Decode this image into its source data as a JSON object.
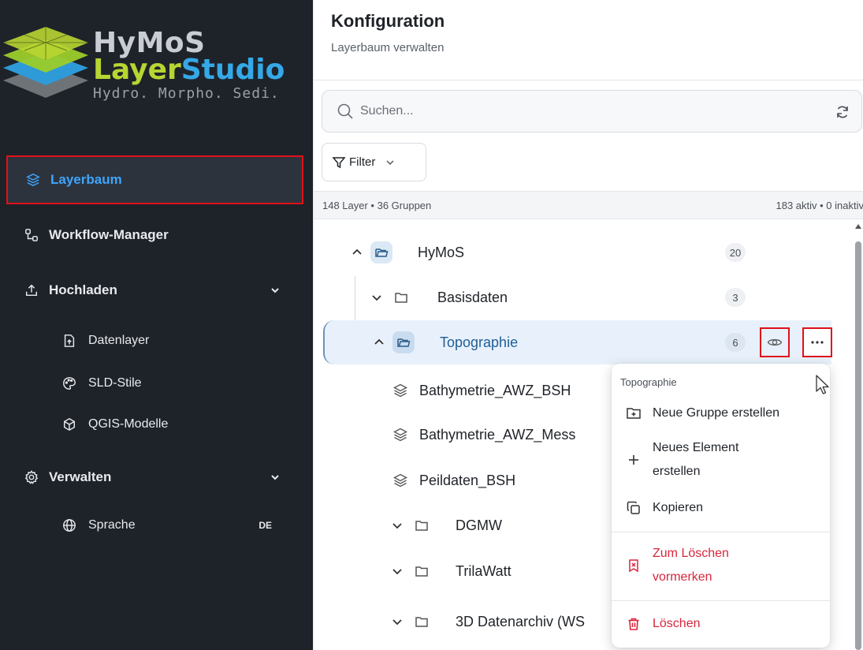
{
  "brand": {
    "name_line1": "HyMoS",
    "name_line2_part1": "Layer",
    "name_line2_part2": "Studio",
    "tagline": "Hydro. Morpho. Sedi."
  },
  "sidebar": {
    "items": [
      {
        "label": "Layerbaum",
        "icon": "layers-icon",
        "active": true
      },
      {
        "label": "Workflow-Manager",
        "icon": "workflow-icon"
      },
      {
        "label": "Hochladen",
        "icon": "upload-icon",
        "expandable": true
      },
      {
        "label": "Datenlayer",
        "icon": "file-upload-icon"
      },
      {
        "label": "SLD-Stile",
        "icon": "palette-icon"
      },
      {
        "label": "QGIS-Modelle",
        "icon": "cube-icon"
      },
      {
        "label": "Verwalten",
        "icon": "settings-icon",
        "expandable": true
      },
      {
        "label": "Sprache",
        "icon": "globe-icon",
        "badge": "DE"
      }
    ]
  },
  "header": {
    "title": "Konfiguration",
    "subtitle": "Layerbaum verwalten"
  },
  "search": {
    "placeholder": "Suchen...",
    "value": ""
  },
  "filter": {
    "label": "Filter"
  },
  "stats": {
    "left": "148 Layer • 36 Gruppen",
    "right": "183 aktiv • 0 inaktiv"
  },
  "tree": {
    "rows": [
      {
        "label": "HyMoS",
        "type": "group",
        "expanded": true,
        "count": "20"
      },
      {
        "label": "Basisdaten",
        "type": "group",
        "expanded": false,
        "count": "3"
      },
      {
        "label": "Topographie",
        "type": "group",
        "expanded": true,
        "count": "6",
        "selected": true
      },
      {
        "label": "Bathymetrie_AWZ_BSH",
        "type": "layer"
      },
      {
        "label": "Bathymetrie_AWZ_Mess",
        "type": "layer"
      },
      {
        "label": "Peildaten_BSH",
        "type": "layer"
      },
      {
        "label": "DGMW",
        "type": "group",
        "expanded": false
      },
      {
        "label": "TrilaWatt",
        "type": "group",
        "expanded": false
      },
      {
        "label": "3D Datenarchiv (WS",
        "type": "group",
        "expanded": false
      }
    ]
  },
  "context_menu": {
    "title": "Topographie",
    "items": [
      {
        "label": "Neue Gruppe erstellen",
        "icon": "folder-plus-icon"
      },
      {
        "label_line1": "Neues Element",
        "label_line2": "erstellen",
        "icon": "plus-icon"
      },
      {
        "label": "Kopieren",
        "icon": "copy-icon"
      },
      {
        "label_line1": "Zum Löschen",
        "label_line2": "vormerken",
        "icon": "bookmark-x-icon",
        "danger": true
      },
      {
        "label": "Löschen",
        "icon": "trash-icon",
        "danger": true
      }
    ]
  },
  "colors": {
    "sidebar_bg": "#1e2329",
    "active_text": "#3fa5ff",
    "highlight_border": "#e0101a",
    "danger": "#d7263d",
    "selected_row": "#e8f1fb"
  }
}
